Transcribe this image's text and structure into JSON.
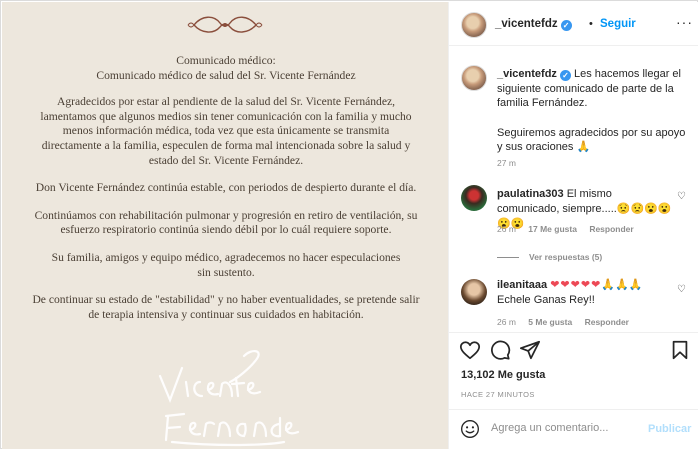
{
  "post_image": {
    "lines": [
      "Comunicado médico:",
      "Comunicado médico de salud del Sr. Vicente Fernández",
      "Agradecidos por estar al pendiente de la salud del Sr. Vicente Fernández,",
      "lamentamos que algunos medios sin tener comunicación con la familia y mucho",
      "menos información médica, toda vez que esta únicamente se transmita",
      "directamente a la familia, especulen de forma mal intencionada sobre la salud y",
      "estado del Sr. Vicente Fernández.",
      "Don Vicente Fernández continúa estable, con periodos de despierto durante el día.",
      "Continúamos con rehabilitación pulmonar y progresión en retiro de ventilación, su",
      "esfuerzo respiratorio continúa siendo débil por lo cuál requiere soporte.",
      "Su familia, amigos y equipo médico, agradecemos no hacer especulaciones",
      "sin sustento.",
      "De continuar su estado de \"estabilidad\" y no haber eventualidades, se pretende salir",
      "de terapia intensiva y continuar sus cuidados en habitación."
    ],
    "signature": "Vicente Fernández",
    "background_color": "#ede7dd",
    "text_color": "#4a3f34"
  },
  "header": {
    "username": "_vicentefdz",
    "separator": "•",
    "follow_label": "Seguir",
    "more_icon": "more-horizontal-icon",
    "more_glyph": "···"
  },
  "caption": {
    "username": "_vicentefdz",
    "text1": "Les hacemos llegar el siguiente comunicado de parte de la familia Fernández.",
    "text2": "Seguiremos agradecidos por su apoyo y sus oraciones 🙏",
    "time": "27 m"
  },
  "comments": [
    {
      "username": "paulatina303",
      "text": "El mismo comunicado, siempre.....",
      "emojis": "😟😟😮😮😮😮",
      "time": "26 m",
      "likes": "17 Me gusta",
      "reply_label": "Responder",
      "view_replies": "Ver respuestas (5)"
    },
    {
      "username": "ileanitaaa",
      "hearts": "❤❤❤❤❤",
      "prayers": "🙏🙏🙏",
      "text": "Echele Ganas Rey!!",
      "time": "26 m",
      "likes": "5 Me gusta",
      "reply_label": "Responder"
    }
  ],
  "actions": {
    "like_icon": "heart-icon",
    "comment_icon": "comment-icon",
    "share_icon": "share-icon",
    "save_icon": "bookmark-icon"
  },
  "stats": {
    "likes": "13,102 Me gusta",
    "posted_ago": "HACE 27 MINUTOS"
  },
  "comment_box": {
    "placeholder": "Agrega un comentario...",
    "publish_label": "Publicar"
  },
  "colors": {
    "accent": "#0095f6",
    "publish_disabled": "#b2dffc",
    "heart": "#ed4956",
    "verified": "#3897f0"
  }
}
